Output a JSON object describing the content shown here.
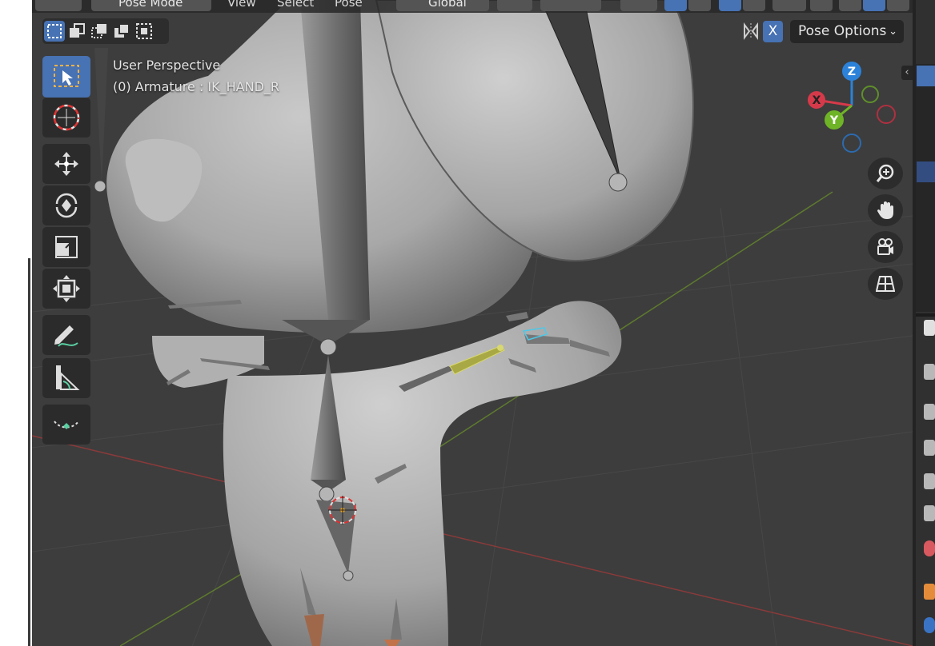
{
  "header": {
    "mode_label": "Pose Mode",
    "menu": [
      "View",
      "Select",
      "Pose"
    ],
    "orientation_label": "Global"
  },
  "viewport": {
    "view_name": "User Perspective",
    "active_object": "(0) Armature : IK_HAND_R",
    "mirror_axis_label": "X",
    "pose_options_label": "Pose Options"
  },
  "gizmo": {
    "axes": [
      "Z",
      "X",
      "Y"
    ],
    "colors": {
      "x": "#d63a4a",
      "y": "#6fb427",
      "z": "#2c82d8"
    }
  },
  "toolbar": [
    {
      "name": "select-box-tool",
      "icon": "select-box-icon",
      "active": true
    },
    {
      "name": "cursor-tool",
      "icon": "cursor-icon",
      "active": false
    },
    {
      "name": "move-tool",
      "icon": "move-icon",
      "active": false
    },
    {
      "name": "rotate-tool",
      "icon": "rotate-icon",
      "active": false
    },
    {
      "name": "scale-tool",
      "icon": "scale-icon",
      "active": false
    },
    {
      "name": "transform-tool",
      "icon": "transform-icon",
      "active": false
    },
    {
      "name": "annotate-tool",
      "icon": "annotate-icon",
      "active": false
    },
    {
      "name": "measure-tool",
      "icon": "measure-icon",
      "active": false
    },
    {
      "name": "relax-tool",
      "icon": "relax-icon",
      "active": false
    }
  ],
  "navigation": [
    "zoom-icon",
    "pan-hand-icon",
    "camera-view-icon",
    "ortho-grid-icon"
  ],
  "colors": {
    "accent": "#4772b3",
    "viewport_bg": "#3d3d3d",
    "selected_bone": "#a8a845",
    "active_bone_outline": "#4ec8e8"
  }
}
